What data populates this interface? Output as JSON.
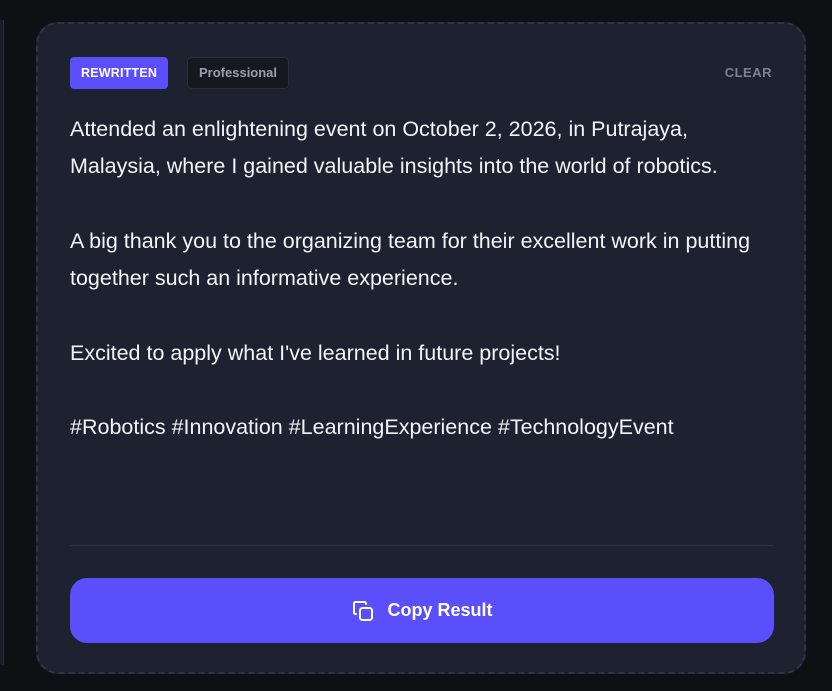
{
  "badges": {
    "status": "REWRITTEN",
    "tone": "Professional"
  },
  "actions": {
    "clear_label": "CLEAR",
    "copy_label": "Copy Result",
    "copy_icon": "copy-icon"
  },
  "result": {
    "paragraphs": [
      "Attended an enlightening event on October 2, 2026, in Putrajaya, Malaysia, where I gained valuable insights into the world of robotics.",
      "A big thank you to the organizing team for their excellent work in putting together such an informative experience.",
      "Excited to apply what I've learned in future projects!",
      "#Robotics #Innovation #LearningExperience #TechnologyEvent"
    ]
  },
  "colors": {
    "accent": "#5b4efb",
    "card_bg": "#1e2130",
    "page_bg": "#0f1014",
    "text": "#f2f3f7"
  }
}
